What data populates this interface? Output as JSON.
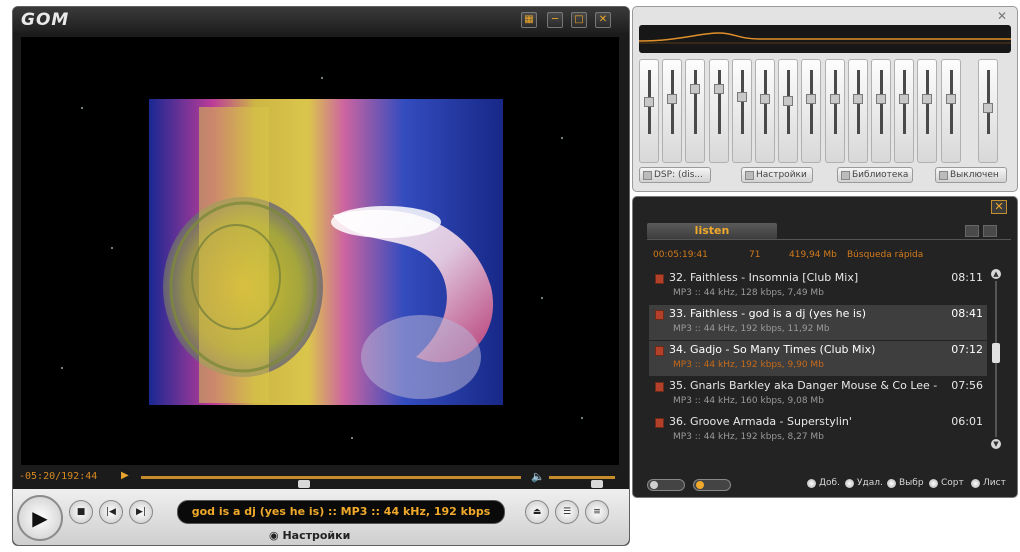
{
  "player": {
    "logo": "GOM",
    "time": "-05:20/192:44",
    "seek_fraction": 0.43,
    "volume_fraction": 0.72,
    "now_playing": "god is a dj (yes he is) :: MP3 :: 44 kHz, 192 kbps",
    "settings_label": "Настройки"
  },
  "equalizer": {
    "buttons": [
      {
        "label": "DSP: (dis..."
      },
      {
        "label": "Настройки"
      },
      {
        "label": "Библиотека"
      },
      {
        "label": "Выключен"
      }
    ],
    "bands": [
      0.5,
      0.45,
      0.3,
      0.3,
      0.42,
      0.45,
      0.48,
      0.45,
      0.45,
      0.45,
      0.45,
      0.45,
      0.45,
      0.45,
      0.6
    ],
    "accent": "#e0902a"
  },
  "playlist": {
    "tab": "listen",
    "stats": {
      "total_time": "00:05:19:41",
      "count": "71",
      "size": "419,94 Mb",
      "search": "Búsqueda rápida"
    },
    "tracks": [
      {
        "title": "32. Faithless - Insomnia [Club Mix]",
        "duration": "08:11",
        "info": "MP3 :: 44 kHz, 128 kbps, 7,49 Mb",
        "state": "normal"
      },
      {
        "title": "33. Faithless - god is a dj (yes he is)",
        "duration": "08:41",
        "info": "MP3 :: 44 kHz, 192 kbps, 11,92 Mb",
        "state": "selected"
      },
      {
        "title": "34. Gadjo - So Many Times (Club Mix)",
        "duration": "07:12",
        "info": "MP3 :: 44 kHz, 192 kbps, 9,90 Mb",
        "state": "playing"
      },
      {
        "title": "35. Gnarls Barkley aka Danger Mouse & Co Lee - ...",
        "duration": "07:56",
        "info": "MP3 :: 44 kHz, 160 kbps, 9,08 Mb",
        "state": "normal"
      },
      {
        "title": "36. Groove Armada - Superstylin'",
        "duration": "06:01",
        "info": "MP3 :: 44 kHz, 192 kbps, 8,27 Mb",
        "state": "normal"
      }
    ],
    "bottom_actions": [
      "Доб.",
      "Удал.",
      "Выбр",
      "Сорт",
      "Лист"
    ],
    "accent": "#f0a92a"
  }
}
